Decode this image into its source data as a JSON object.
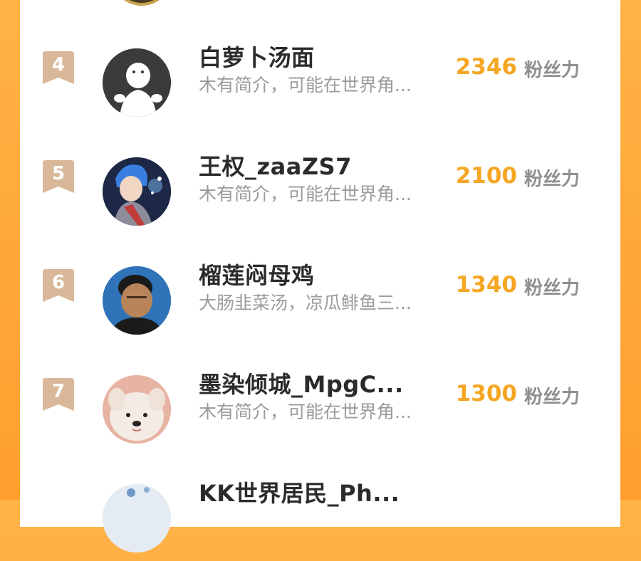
{
  "leaderboard": {
    "unit_label": "粉丝力",
    "rows": [
      {
        "rank": "4",
        "name": "白萝卜汤面",
        "bio": "木有简介，可能在世界角...",
        "score": "2346",
        "avatar_icon": "default-user-avatar"
      },
      {
        "rank": "5",
        "name": "王权_zaaZS7",
        "bio": "木有简介，可能在世界角...",
        "score": "2100",
        "avatar_icon": "anime-character-avatar"
      },
      {
        "rank": "6",
        "name": "榴莲闷母鸡",
        "bio": "大肠韭菜汤，凉瓜鲱鱼三...",
        "score": "1340",
        "avatar_icon": "photo-person-avatar"
      },
      {
        "rank": "7",
        "name": "墨染倾城_MpgC...",
        "bio": "木有简介，可能在世界角...",
        "score": "1300",
        "avatar_icon": "dog-photo-avatar"
      },
      {
        "rank": "",
        "name": "KK世界居民_Ph...",
        "bio": "",
        "score": "",
        "avatar_icon": "partial-avatar"
      }
    ]
  },
  "colors": {
    "background": "#ffa83a",
    "rank_badge": "#d9b89a",
    "score": "#f5a623",
    "name": "#2b2b2b",
    "bio": "#9b9b9b"
  }
}
